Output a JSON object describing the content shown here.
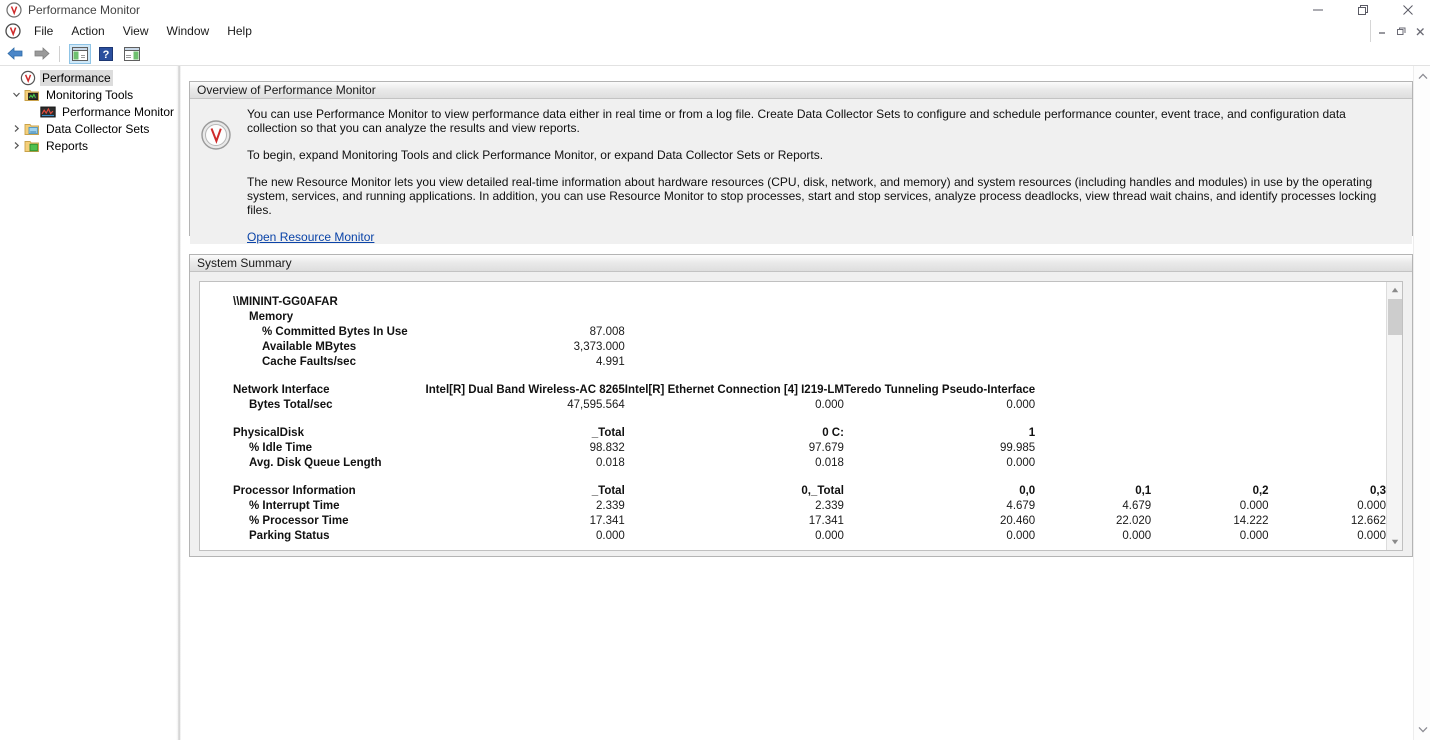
{
  "window": {
    "title": "Performance Monitor",
    "app_icon": "perfmon-icon",
    "controls": {
      "minimize": "—",
      "restore": "❐",
      "close": "✕"
    }
  },
  "menubar": {
    "icon": "perfmon-icon",
    "items": [
      "File",
      "Action",
      "View",
      "Window",
      "Help"
    ],
    "mdi_controls": {
      "minimize": "–",
      "restore": "❐",
      "close": "✕"
    }
  },
  "toolbar": {
    "buttons": [
      {
        "name": "back-button",
        "icon": "arrow-left-icon",
        "label": "Back",
        "active": false
      },
      {
        "name": "forward-button",
        "icon": "arrow-right-icon",
        "label": "Forward",
        "active": false
      },
      {
        "name": "show-console-tree-button",
        "icon": "console-tree-icon",
        "label": "Show/Hide Console Tree",
        "active": true
      },
      {
        "name": "help-button",
        "icon": "question-mark-icon",
        "label": "Help",
        "active": false
      },
      {
        "name": "show-action-pane-button",
        "icon": "action-pane-icon",
        "label": "Show/Hide Action Pane",
        "active": false
      }
    ]
  },
  "tree": {
    "items": [
      {
        "label": "Performance",
        "icon": "perfmon-icon",
        "depth": 0,
        "expander": "",
        "selected": true
      },
      {
        "label": "Monitoring Tools",
        "icon": "monitoring-tools-folder-icon",
        "depth": 1,
        "expander": "⌄",
        "selected": false
      },
      {
        "label": "Performance Monitor",
        "icon": "performance-monitor-icon",
        "depth": 2,
        "expander": "",
        "selected": false
      },
      {
        "label": "Data Collector Sets",
        "icon": "data-collector-folder-icon",
        "depth": 1,
        "expander": "›",
        "selected": false
      },
      {
        "label": "Reports",
        "icon": "reports-folder-icon",
        "depth": 1,
        "expander": "›",
        "selected": false
      }
    ]
  },
  "overview": {
    "header": "Overview of Performance Monitor",
    "icon": "gauge-icon",
    "paragraphs": [
      "You can use Performance Monitor to view performance data either in real time or from a log file. Create Data Collector Sets to configure and schedule performance counter, event trace, and configuration data collection so that you can analyze the results and view reports.",
      "To begin, expand Monitoring Tools and click Performance Monitor, or expand Data Collector Sets or Reports.",
      "The new Resource Monitor lets you view detailed real-time information about hardware resources (CPU, disk, network, and memory) and system resources (including handles and modules) in use by the operating system, services, and running applications. In addition, you can use Resource Monitor to stop processes, start and stop services, analyze process deadlocks, view thread wait chains, and identify processes locking files."
    ],
    "link": "Open Resource Monitor"
  },
  "system_summary": {
    "header": "System Summary",
    "computer": "\\\\MININT-GG0AFAR",
    "groups": [
      {
        "name": "Memory",
        "columns": [],
        "rows": [
          {
            "label": "% Committed Bytes In Use",
            "values": [
              "87.008"
            ]
          },
          {
            "label": "Available MBytes",
            "values": [
              "3,373.000"
            ]
          },
          {
            "label": "Cache Faults/sec",
            "values": [
              "4.991"
            ]
          }
        ]
      },
      {
        "name": "Network Interface",
        "columns": [
          "Intel[R] Dual Band Wireless-AC 8265",
          "Intel[R] Ethernet Connection [4] I219-LM",
          "Teredo Tunneling Pseudo-Interface"
        ],
        "rows": [
          {
            "label": "Bytes Total/sec",
            "values": [
              "47,595.564",
              "0.000",
              "0.000"
            ]
          }
        ]
      },
      {
        "name": "PhysicalDisk",
        "columns": [
          "_Total",
          "0 C:",
          "1"
        ],
        "rows": [
          {
            "label": "% Idle Time",
            "values": [
              "98.832",
              "97.679",
              "99.985"
            ]
          },
          {
            "label": "Avg. Disk Queue Length",
            "values": [
              "0.018",
              "0.018",
              "0.000"
            ]
          }
        ]
      },
      {
        "name": "Processor Information",
        "columns": [
          "_Total",
          "0,_Total",
          "0,0",
          "0,1",
          "0,2",
          "0,3"
        ],
        "rows": [
          {
            "label": "% Interrupt Time",
            "values": [
              "2.339",
              "2.339",
              "4.679",
              "4.679",
              "0.000",
              "0.000"
            ]
          },
          {
            "label": "% Processor Time",
            "values": [
              "17.341",
              "17.341",
              "20.460",
              "22.020",
              "14.222",
              "12.662"
            ]
          },
          {
            "label": "Parking Status",
            "values": [
              "0.000",
              "0.000",
              "0.000",
              "0.000",
              "0.000",
              "0.000"
            ]
          }
        ]
      }
    ],
    "scrollbar": {
      "up": "▲",
      "down": "▼"
    }
  },
  "colors": {
    "link": "#0b44a8",
    "panel_bg": "#f0f0f0",
    "panel_border": "#b4b4b4",
    "selection": "#dcdcdc",
    "toolbar_active": "#cfe8f8"
  }
}
